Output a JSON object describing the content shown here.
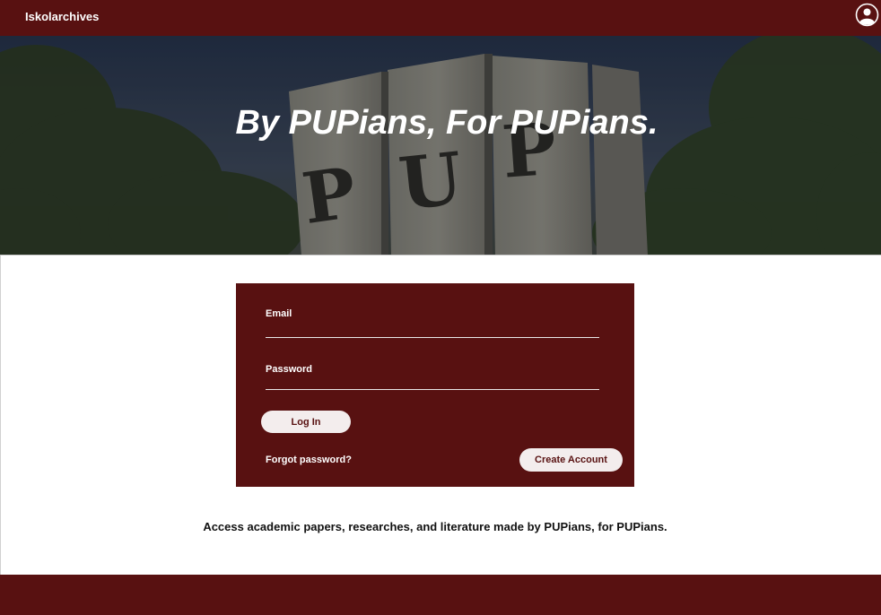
{
  "header": {
    "brand": "Iskolarchives",
    "profile_icon": "user-circle-icon"
  },
  "hero": {
    "title": "By PUPians, For PUPians.",
    "monument_letters": [
      "P",
      "U",
      "P"
    ]
  },
  "login": {
    "email_label": "Email",
    "email_value": "",
    "password_label": "Password",
    "password_value": "",
    "login_label": "Log In",
    "forgot_label": "Forgot password?",
    "create_label": "Create Account"
  },
  "tagline": "Access academic papers, researches, and literature made by PUPians, for PUPians.",
  "colors": {
    "maroon": "#581111",
    "button_bg": "#f3eded",
    "text_white": "#ffffff"
  }
}
